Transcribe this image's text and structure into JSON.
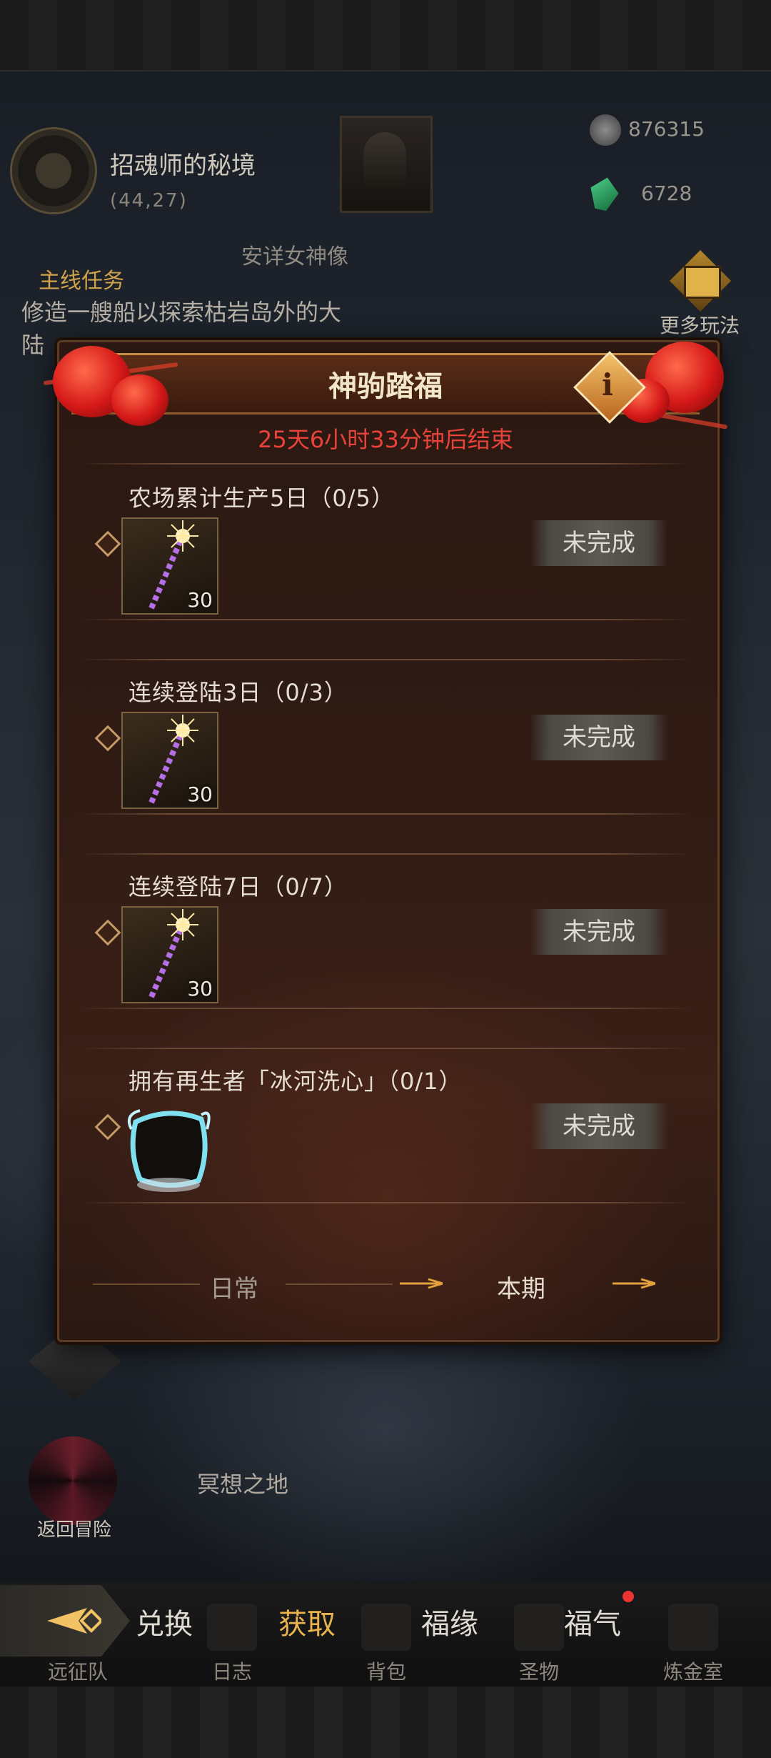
{
  "scene": {
    "area_name": "招魂师的秘境",
    "area_coords": "(44,27)",
    "resources": [
      {
        "name": "silver-ore",
        "value": "876315",
        "icon": "ore-icon"
      },
      {
        "name": "emerald",
        "value": "6728",
        "icon": "gem-icon"
      }
    ],
    "statue_label": "安详女神像",
    "quest": {
      "title": "主线任务",
      "text": "修造一艘船以探索枯岩岛外的大陆"
    },
    "more_play_label": "更多玩法",
    "meditate_label": "冥想之地",
    "return_label": "返回冒险"
  },
  "modal": {
    "title": "神驹踏福",
    "countdown": "25天6小时33分钟后结束",
    "tasks": [
      {
        "title": "农场累计生产5日（0/5）",
        "reward_icon": "sparkler-icon",
        "reward_count": "30",
        "status": "未完成"
      },
      {
        "title": "连续登陆3日（0/3）",
        "reward_icon": "sparkler-icon",
        "reward_count": "30",
        "status": "未完成"
      },
      {
        "title": "连续登陆7日（0/7）",
        "reward_icon": "sparkler-icon",
        "reward_count": "30",
        "status": "未完成"
      },
      {
        "title": "拥有再生者「冰河洗心」（0/1）",
        "reward_icon": "ice-frame-icon",
        "reward_count": "",
        "status": "未完成"
      }
    ],
    "tabs": {
      "daily": "日常",
      "current": "本期"
    }
  },
  "nav_tabs": [
    "兑换",
    "获取",
    "福缘",
    "福气"
  ],
  "bottom_nav": [
    "远征队",
    "日志",
    "背包",
    "圣物",
    "炼金室"
  ],
  "colors": {
    "accent_gold": "#e9b34f",
    "countdown_red": "#e8433a",
    "modal_bg": "#2f1b14"
  }
}
